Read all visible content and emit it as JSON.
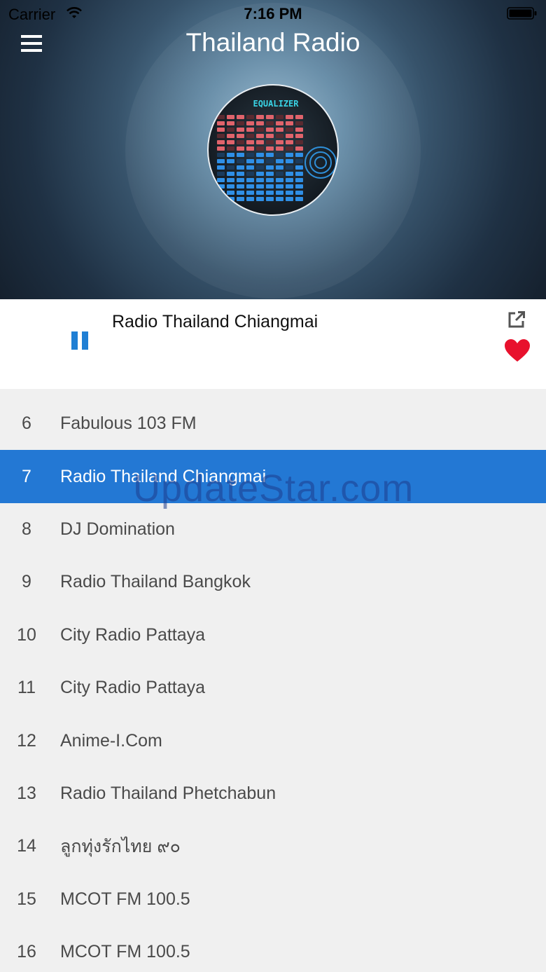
{
  "status_bar": {
    "carrier": "Carrier",
    "time": "7:16 PM"
  },
  "header": {
    "title": "Thailand Radio",
    "logo_text": "EQUALIZER"
  },
  "now_playing": {
    "station": "Radio Thailand Chiangmai",
    "state": "playing",
    "accent_color": "#1f7fd4",
    "favorite_color": "#e8112d"
  },
  "stations": [
    {
      "num": "6",
      "name": "Fabulous 103 FM",
      "active": false
    },
    {
      "num": "7",
      "name": "Radio Thailand Chiangmai",
      "active": true
    },
    {
      "num": "8",
      "name": "DJ Domination",
      "active": false
    },
    {
      "num": "9",
      "name": "Radio Thailand Bangkok",
      "active": false
    },
    {
      "num": "10",
      "name": "City Radio Pattaya",
      "active": false
    },
    {
      "num": "11",
      "name": "City Radio Pattaya",
      "active": false
    },
    {
      "num": "12",
      "name": "Anime-I.Com",
      "active": false
    },
    {
      "num": "13",
      "name": "Radio Thailand Phetchabun",
      "active": false
    },
    {
      "num": "14",
      "name": "ลูกทุ่งรักไทย ๙๐",
      "active": false
    },
    {
      "num": "15",
      "name": "MCOT FM 100.5",
      "active": false
    },
    {
      "num": "16",
      "name": "MCOT FM 100.5",
      "active": false
    }
  ],
  "watermark": "UpdateStar.com",
  "colors": {
    "selected_row": "#2378d4",
    "list_background": "#f0f0f0"
  }
}
